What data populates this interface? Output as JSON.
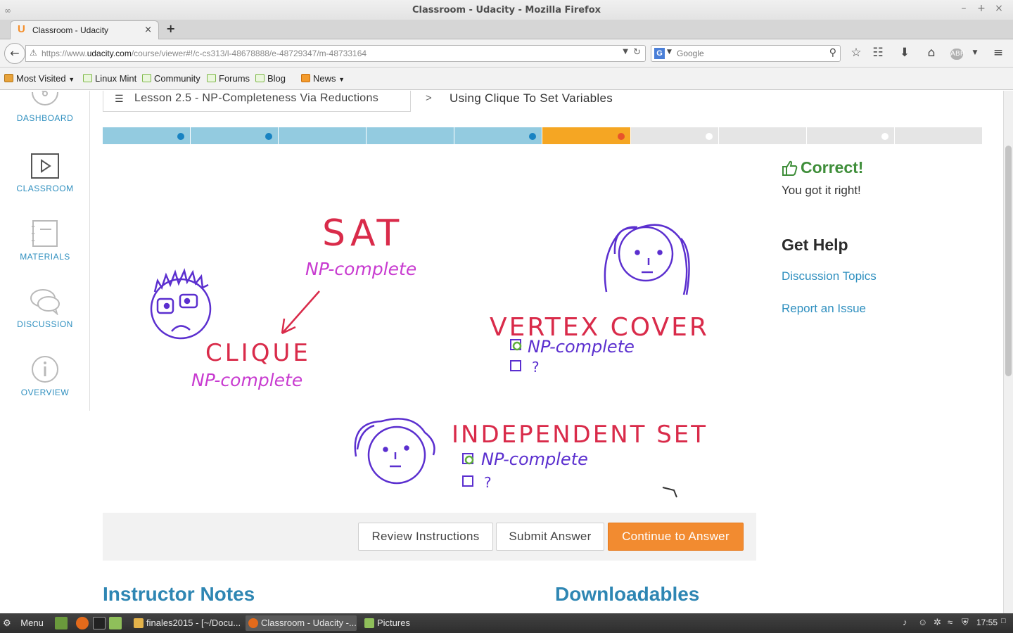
{
  "window": {
    "title": "Classroom - Udacity - Mozilla Firefox",
    "minimize": "–",
    "maximize": "+",
    "close": "×"
  },
  "tab": {
    "favicon": "U",
    "label": "Classroom - Udacity",
    "close": "×",
    "new_tab": "+"
  },
  "nav": {
    "url_prefix": "https://www.",
    "url_host": "udacity.com",
    "url_path": "/course/viewer#!/c-cs313/l-48678888/e-48729347/m-48733164",
    "search_engine": "G",
    "search_placeholder": "Google"
  },
  "bookmarks": [
    {
      "label": "Most Visited",
      "icon": "folder",
      "dropdown": true
    },
    {
      "label": "Linux Mint",
      "icon": "mint"
    },
    {
      "label": "Community",
      "icon": "mint"
    },
    {
      "label": "Forums",
      "icon": "mint"
    },
    {
      "label": "Blog",
      "icon": "mint"
    },
    {
      "label": "News",
      "icon": "rss",
      "dropdown": true
    }
  ],
  "sidenav": [
    {
      "label": "DASHBOARD",
      "icon": "dashboard-icon"
    },
    {
      "label": "CLASSROOM",
      "icon": "play-icon"
    },
    {
      "label": "MATERIALS",
      "icon": "notebook-icon"
    },
    {
      "label": "DISCUSSION",
      "icon": "speech-bubbles-icon"
    },
    {
      "label": "OVERVIEW",
      "icon": "info-icon"
    }
  ],
  "breadcrumb": {
    "lesson": "Lesson 2.5 - NP-Completeness Via Reductions",
    "separator": ">",
    "current": "Using Clique To Set Variables"
  },
  "progress": {
    "segments": [
      "done",
      "done",
      "done",
      "done",
      "done",
      "current",
      "todo",
      "todo",
      "todo",
      "todo"
    ],
    "dots": [
      true,
      true,
      false,
      false,
      true,
      true,
      true,
      false,
      true,
      false
    ],
    "current_index": 5
  },
  "drawing": {
    "sat": "SAT",
    "sat_status": "NP-complete",
    "clique": "CLIQUE",
    "clique_status": "NP-complete",
    "vertex_cover": "VERTEX COVER",
    "vc_option_1": "NP-complete",
    "vc_option_2": "?",
    "independent_set": "INDEPENDENT SET",
    "is_option_1": "NP-complete",
    "is_option_2": "?"
  },
  "quiz": {
    "review": "Review Instructions",
    "submit": "Submit Answer",
    "continue": "Continue to Answer"
  },
  "feedback": {
    "title": "Correct!",
    "subtitle": "You got it right!"
  },
  "help": {
    "title": "Get Help",
    "discussion": "Discussion Topics",
    "report": "Report an Issue"
  },
  "sections": {
    "notes": "Instructor Notes",
    "downloads": "Downloadables"
  },
  "taskbar": {
    "menu": "Menu",
    "tasks": [
      {
        "label": "finales2015 - [~/Docu...",
        "active": false
      },
      {
        "label": "Classroom - Udacity -...",
        "active": true
      },
      {
        "label": "Pictures",
        "active": false
      }
    ],
    "clock": "17:55"
  },
  "colors": {
    "accent_blue": "#2e8fbf",
    "progress_done": "#93cbe0",
    "progress_current": "#f5a623",
    "correct_green": "#3f8e3a",
    "primary_orange": "#f28b30"
  }
}
